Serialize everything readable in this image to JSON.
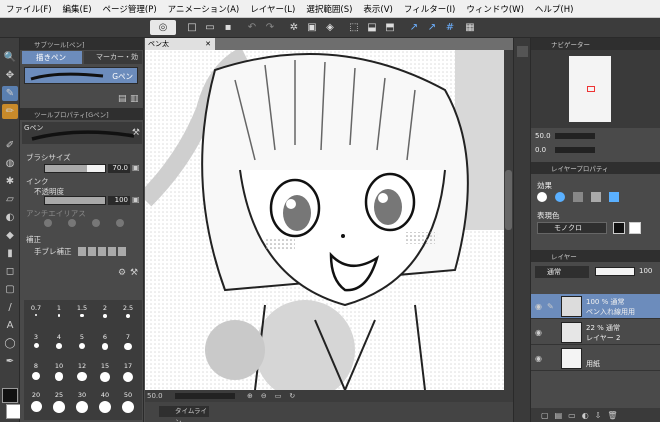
{
  "menu": [
    "ファイル(F)",
    "編集(E)",
    "ページ管理(P)",
    "アニメーション(A)",
    "レイヤー(L)",
    "選択範囲(S)",
    "表示(V)",
    "フィルター(I)",
    "ウィンドウ(W)",
    "ヘルプ(H)"
  ],
  "subtool": {
    "title": "サブツール[ペン]",
    "tab_pen": "描きペン",
    "tab_marker": "マーカー・効",
    "brush_name": "Gペン"
  },
  "toolprop": {
    "title": "ツールプロパティ[Gペン]",
    "brush_name": "Gペン",
    "brush_size_label": "ブラシサイズ",
    "brush_size_value": "70.0",
    "brush_size_fraction": 0.7,
    "ink_label": "インク",
    "opacity_label": "不透明度",
    "opacity_value": "100",
    "opacity_fraction": 1.0,
    "antialias_label": "アンチエイリアス",
    "correction_label": "補正",
    "stabilize_label": "手ブレ補正"
  },
  "brush_sizes": [
    "0.7",
    "1",
    "1.5",
    "2",
    "2.5",
    "3",
    "4",
    "5",
    "6",
    "7",
    "8",
    "10",
    "12",
    "15",
    "17",
    "20",
    "25",
    "30",
    "40",
    "50"
  ],
  "canvas": {
    "doc_tab": "ペン太",
    "zoom": "50.0",
    "timeline_tab": "タイムライン"
  },
  "navigator": {
    "title": "ナビゲーター",
    "zoom": "50.0",
    "angle": "0.0"
  },
  "layerprop": {
    "title": "レイヤープロパティ",
    "effect_label": "効果",
    "expression_label": "表現色",
    "expression_value": "モノクロ"
  },
  "layers_panel": {
    "title": "レイヤー",
    "blend_mode": "通常",
    "opacity": "100",
    "layers": [
      {
        "line1": "100 % 通常",
        "line2": "ペン入れ線用用"
      },
      {
        "line1": "22 % 通常",
        "line2": "レイヤー 2"
      },
      {
        "line1": "",
        "line2": "用紙"
      }
    ]
  },
  "colors": {
    "accent": "#6c8cbc",
    "panel": "#4a4a4a",
    "title": "#2f2f2f"
  }
}
